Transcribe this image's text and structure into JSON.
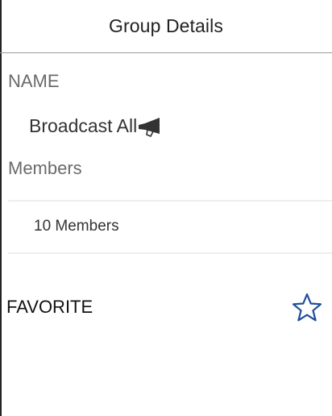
{
  "header": {
    "title": "Group Details"
  },
  "name_section": {
    "label": "NAME",
    "value": "Broadcast All",
    "icon": "megaphone-icon"
  },
  "members_section": {
    "label": "Members",
    "count_text": "10 Members"
  },
  "favorite": {
    "label": "FAVORITE",
    "icon": "star-outline-icon",
    "is_favorite": false
  },
  "colors": {
    "text_primary": "#222222",
    "text_label": "#6a6a6a",
    "star_stroke": "#1f4e9a",
    "divider": "#eeeeee",
    "header_border": "#9a9a9a"
  }
}
